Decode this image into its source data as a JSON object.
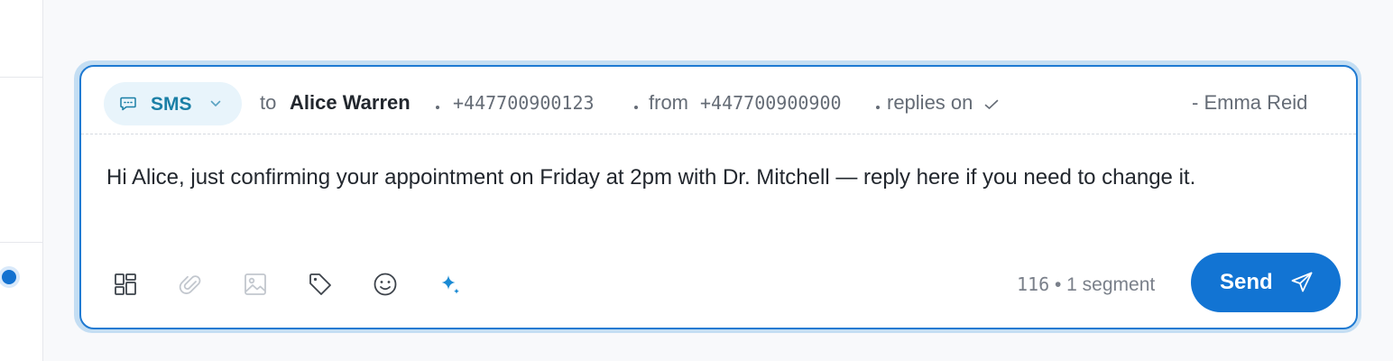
{
  "channel": {
    "label": "SMS",
    "icon": "chat-bubble-icon",
    "accent": "#1a7fa6"
  },
  "recipient": {
    "to_label": "to",
    "name": "Alice Warren",
    "phone": "+447700900123"
  },
  "sender": {
    "from_label": "from",
    "phone": "+447700900900",
    "replies_label": "replies on"
  },
  "author": "- Emma Reid",
  "message": {
    "text": "Hi Alice, just confirming your appointment on Friday at 2pm with Dr. Mitchell — reply here if you need to change it."
  },
  "toolbar": {
    "icons": [
      "templates-icon",
      "attachment-icon",
      "image-icon",
      "tag-icon",
      "emoji-icon",
      "ai-sparkle-icon"
    ]
  },
  "counter": {
    "characters": "116",
    "segments": "1 segment"
  },
  "send": {
    "label": "Send",
    "color": "#1274d3"
  }
}
